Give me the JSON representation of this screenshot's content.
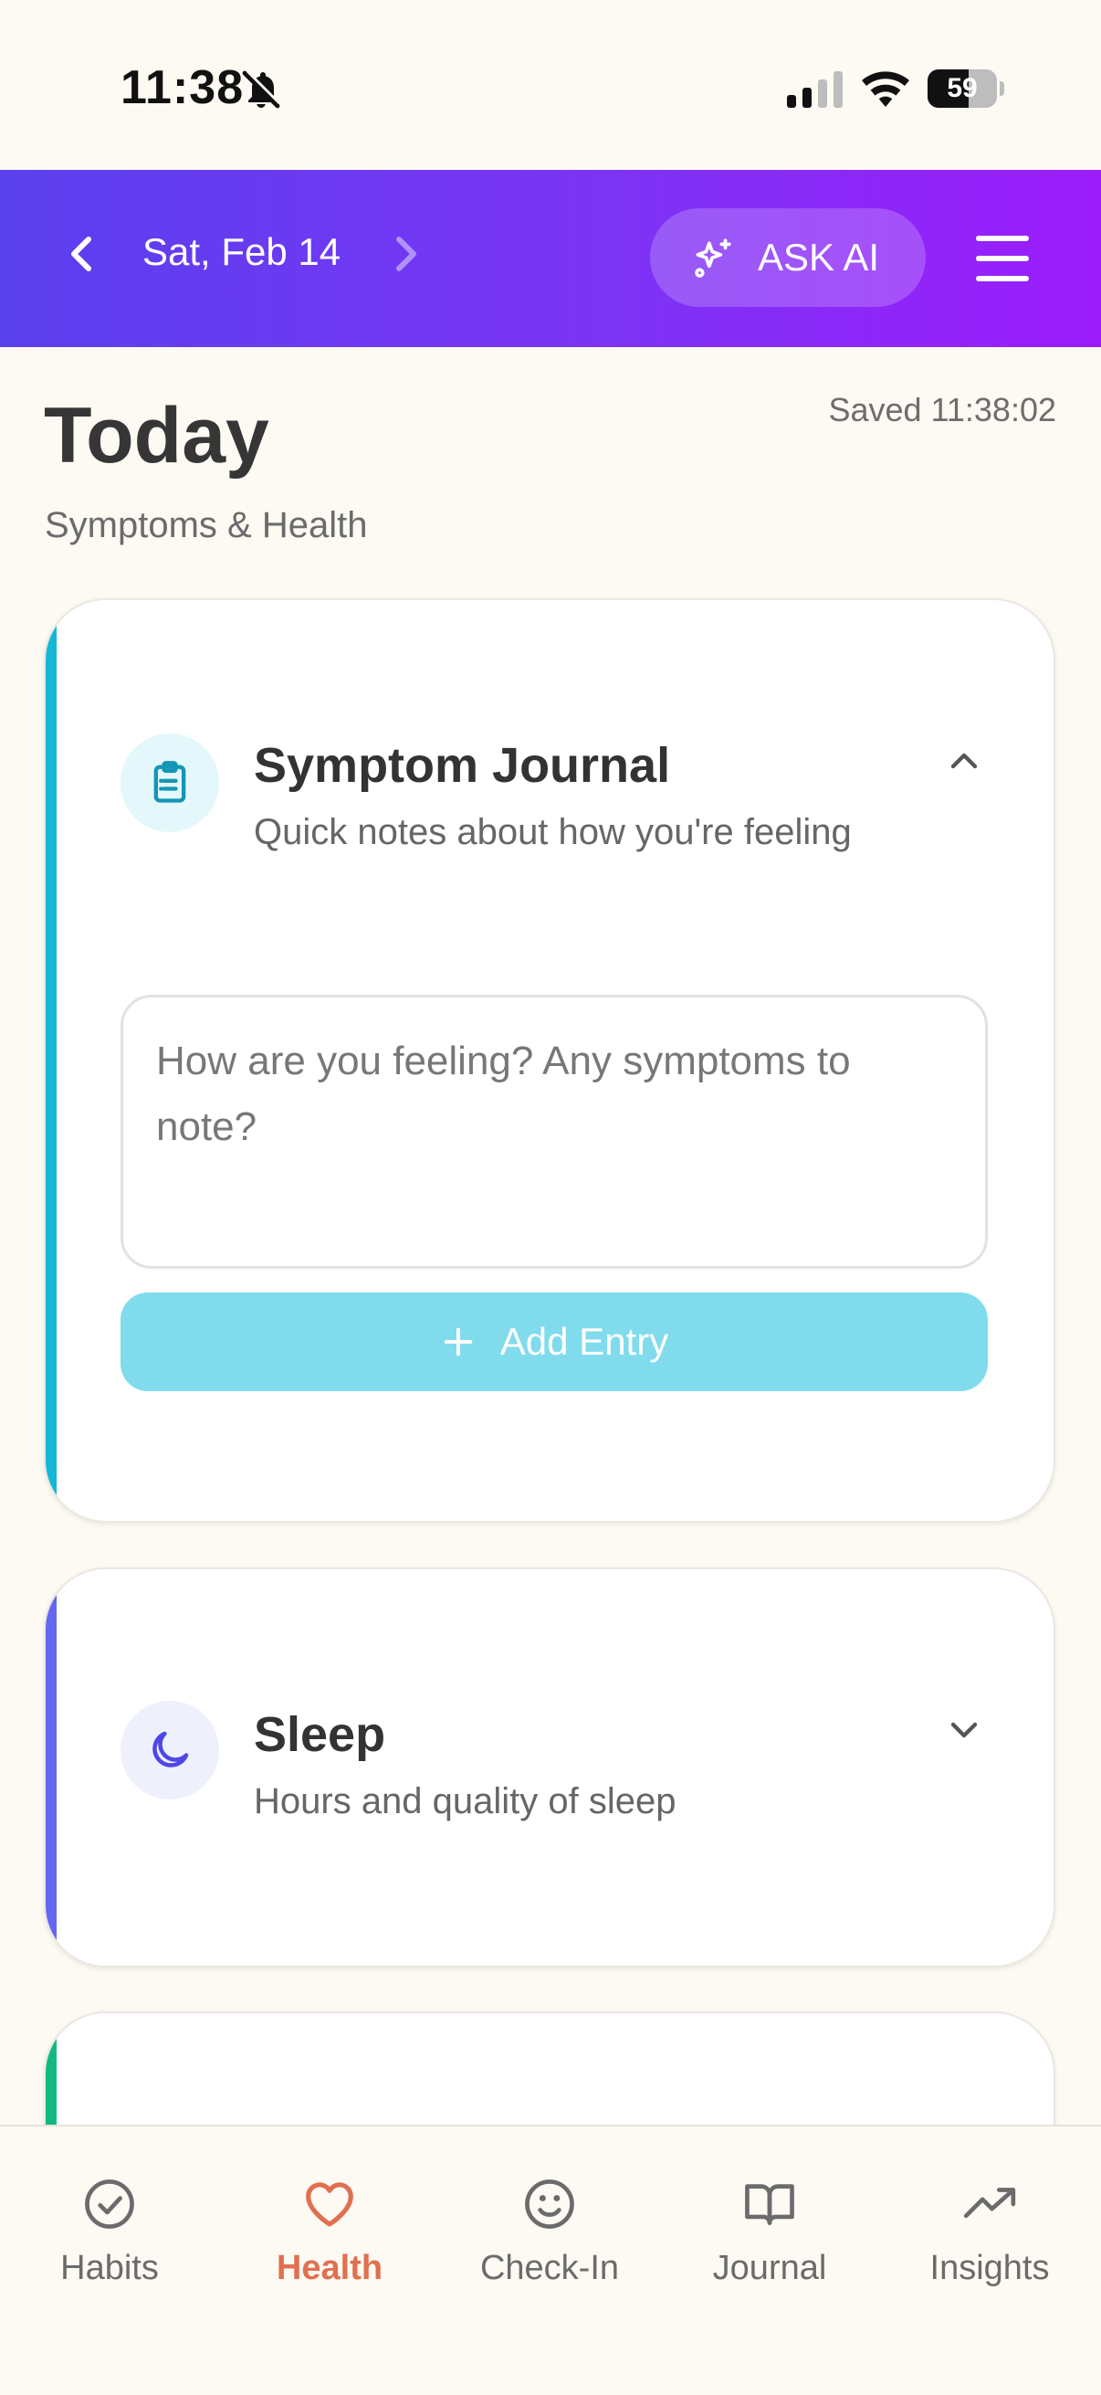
{
  "status_bar": {
    "time": "11:38",
    "battery_level": "59",
    "battery_fraction": 0.59
  },
  "header": {
    "date": "Sat, Feb 14",
    "ask_ai_label": "ASK AI",
    "gradient_colors": [
      "#5a40ee",
      "#9c1cfb"
    ]
  },
  "page": {
    "title": "Today",
    "subtitle": "Symptoms & Health",
    "saved_status": "Saved 11:38:02"
  },
  "cards": {
    "journal": {
      "title": "Symptom Journal",
      "description": "Quick notes about how you're feeling",
      "input_placeholder": "How are you feeling? Any symptoms to note?",
      "input_value": "",
      "add_label": "Add Entry",
      "accent_color": "#14b8d4",
      "icon": "clipboard-icon",
      "expanded": true
    },
    "sleep": {
      "title": "Sleep",
      "description": "Hours and quality of sleep",
      "accent_color": "#6366f1",
      "icon": "moon-icon",
      "expanded": false
    },
    "third": {
      "accent_color": "#10b981"
    }
  },
  "tabs": [
    {
      "label": "Habits",
      "icon": "check-circle-icon",
      "active": false
    },
    {
      "label": "Health",
      "icon": "heart-icon",
      "active": true
    },
    {
      "label": "Check-In",
      "icon": "smile-icon",
      "active": false
    },
    {
      "label": "Journal",
      "icon": "book-icon",
      "active": false
    },
    {
      "label": "Insights",
      "icon": "trending-up-icon",
      "active": false
    }
  ],
  "colors": {
    "background": "#fdf9f3",
    "active_tab": "#e0704f",
    "inactive_tab": "#6b6b6b"
  }
}
